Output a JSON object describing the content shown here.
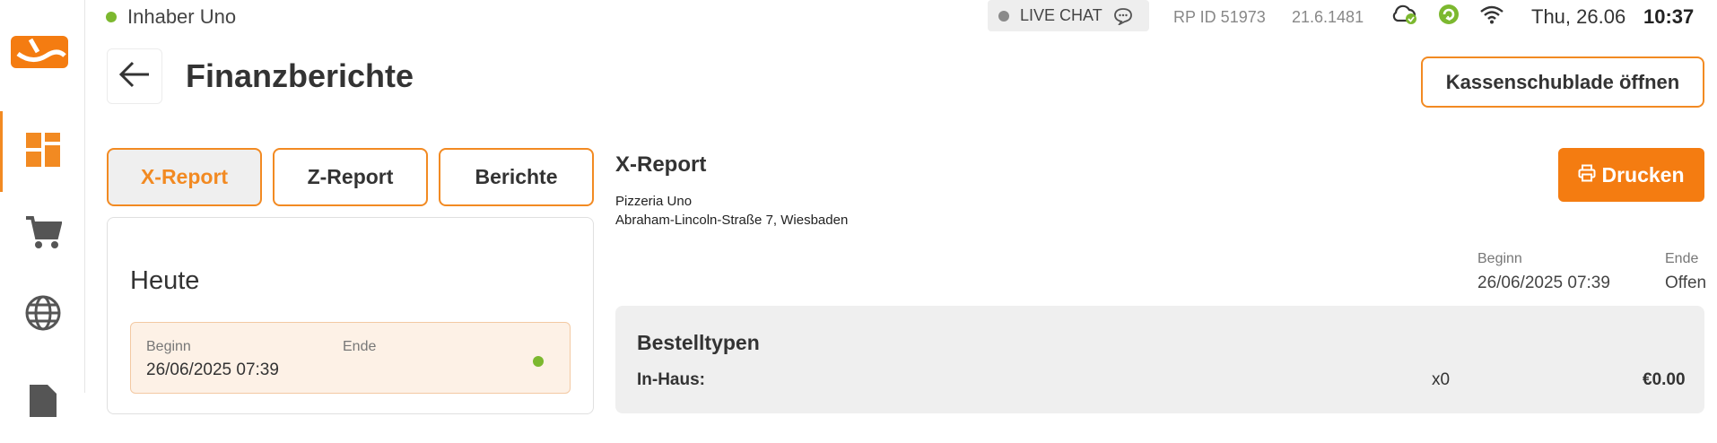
{
  "topbar": {
    "user_name": "Inhaber Uno",
    "live_chat_label": "LIVE CHAT",
    "rp_id": "RP ID 51973",
    "version": "21.6.1481",
    "date": "Thu, 26.06",
    "time": "10:37"
  },
  "sidebar": {
    "items": [
      {
        "name": "dashboard",
        "icon": "dashboard-icon",
        "active": true
      },
      {
        "name": "cart",
        "icon": "cart-icon",
        "active": false
      },
      {
        "name": "globe",
        "icon": "globe-icon",
        "active": false
      },
      {
        "name": "document",
        "icon": "document-icon",
        "active": false
      }
    ]
  },
  "header": {
    "title": "Finanzberichte",
    "drawer_button": "Kassenschublade öffnen"
  },
  "tabs": [
    {
      "label": "X-Report",
      "active": true
    },
    {
      "label": "Z-Report",
      "active": false
    },
    {
      "label": "Berichte",
      "active": false
    }
  ],
  "card": {
    "title": "Heute",
    "begin_label": "Beginn",
    "begin_value": "26/06/2025 07:39",
    "end_label": "Ende"
  },
  "report": {
    "title": "X-Report",
    "business_name": "Pizzeria Uno",
    "address": "Abraham-Lincoln-Straße 7, Wiesbaden",
    "print_label": "Drucken",
    "begin_label": "Beginn",
    "begin_value": "26/06/2025 07:39",
    "end_label": "Ende",
    "end_value": "Offen",
    "order_types": {
      "title": "Bestelltypen",
      "rows": [
        {
          "label": "In-Haus:",
          "count": "x0",
          "amount": "€0.00"
        }
      ]
    }
  },
  "colors": {
    "accent": "#f28a22",
    "print_button": "#f47c11",
    "online": "#7cb82f"
  }
}
